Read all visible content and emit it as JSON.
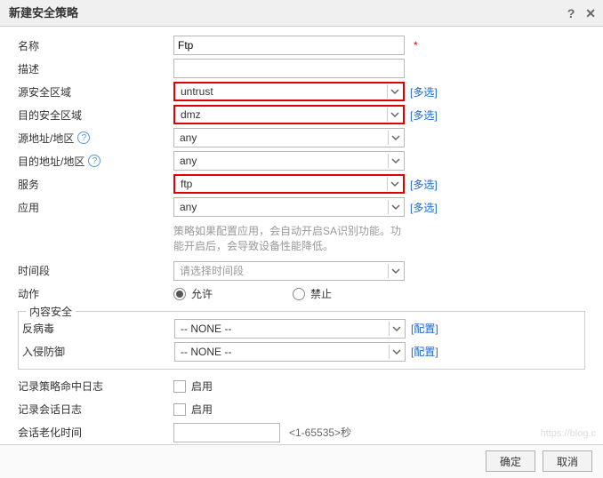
{
  "title": "新建安全策略",
  "labels": {
    "name": "名称",
    "desc": "描述",
    "srcZone": "源安全区域",
    "dstZone": "目的安全区域",
    "srcAddr": "源地址/地区",
    "dstAddr": "目的地址/地区",
    "service": "服务",
    "app": "应用",
    "time": "时间段",
    "action": "动作",
    "contentSec": "内容安全",
    "antivirus": "反病毒",
    "ips": "入侵防御",
    "logHit": "记录策略命中日志",
    "logSession": "记录会话日志",
    "sessionAging": "会话老化时间"
  },
  "values": {
    "name": "Ftp",
    "desc": "",
    "srcZone": "untrust",
    "dstZone": "dmz",
    "srcAddr": "any",
    "dstAddr": "any",
    "service": "ftp",
    "app": "any",
    "timePlaceholder": "请选择时间段",
    "antivirus": "-- NONE --",
    "ips": "-- NONE --",
    "sessionAging": ""
  },
  "links": {
    "multi": "[多选]",
    "config": "[配置]"
  },
  "hint": "策略如果配置应用，会自动开启SA识别功能。功能开启后，会导致设备性能降低。",
  "radio": {
    "allow": "允许",
    "deny": "禁止"
  },
  "checkbox": {
    "enable": "启用"
  },
  "sessionSuffix": "<1-65535>秒",
  "buttons": {
    "ok": "确定",
    "cancel": "取消"
  },
  "watermark": "https://blog.c"
}
